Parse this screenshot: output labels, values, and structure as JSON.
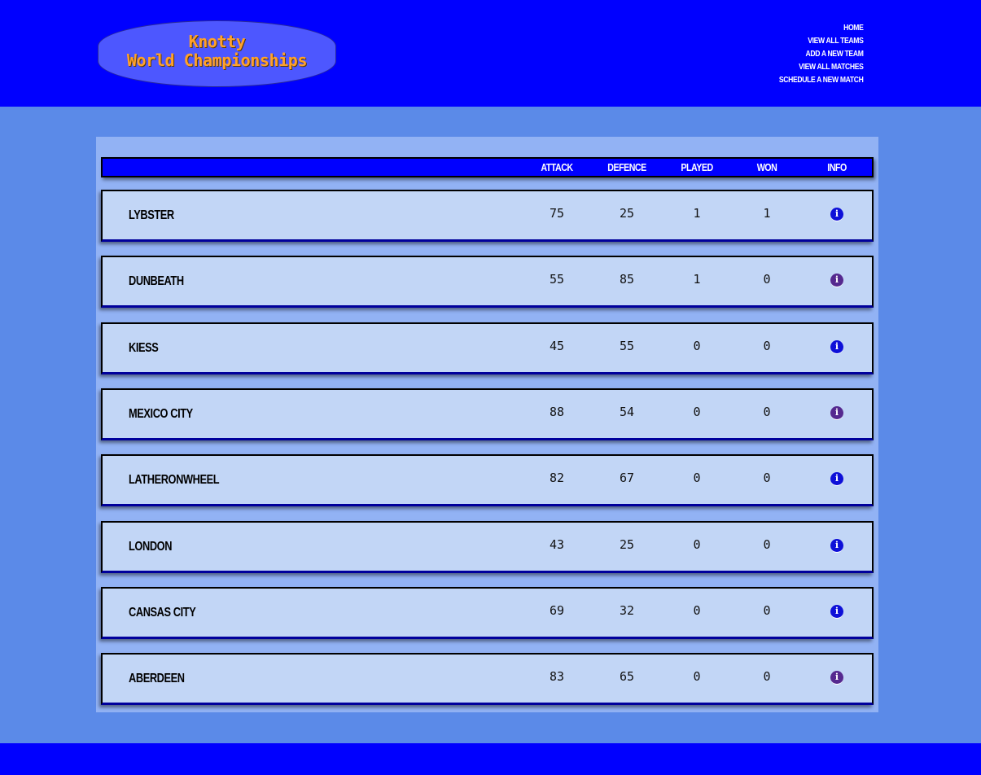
{
  "logo": {
    "line1": "Knotty",
    "line2": "World Championships"
  },
  "nav": {
    "items": [
      {
        "label": "HOME"
      },
      {
        "label": "VIEW ALL TEAMS"
      },
      {
        "label": "ADD A NEW TEAM"
      },
      {
        "label": "VIEW ALL MATCHES"
      },
      {
        "label": "SCHEDULE A NEW MATCH"
      }
    ]
  },
  "table": {
    "headers": {
      "attack": "ATTACK",
      "defence": "DEFENCE",
      "played": "PLAYED",
      "won": "WON",
      "info": "INFO"
    },
    "rows": [
      {
        "name": "LYBSTER",
        "attack": "75",
        "defence": "25",
        "played": "1",
        "won": "1",
        "info_icon": "info-icon",
        "link_state": "unvisited"
      },
      {
        "name": "DUNBEATH",
        "attack": "55",
        "defence": "85",
        "played": "1",
        "won": "0",
        "info_icon": "info-icon",
        "link_state": "visited"
      },
      {
        "name": "KIESS",
        "attack": "45",
        "defence": "55",
        "played": "0",
        "won": "0",
        "info_icon": "info-icon",
        "link_state": "unvisited"
      },
      {
        "name": "MEXICO CITY",
        "attack": "88",
        "defence": "54",
        "played": "0",
        "won": "0",
        "info_icon": "info-icon",
        "link_state": "visited"
      },
      {
        "name": "LATHERONWHEEL",
        "attack": "82",
        "defence": "67",
        "played": "0",
        "won": "0",
        "info_icon": "info-icon",
        "link_state": "unvisited"
      },
      {
        "name": "LONDON",
        "attack": "43",
        "defence": "25",
        "played": "0",
        "won": "0",
        "info_icon": "info-icon",
        "link_state": "unvisited"
      },
      {
        "name": "CANSAS CITY",
        "attack": "69",
        "defence": "32",
        "played": "0",
        "won": "0",
        "info_icon": "info-icon",
        "link_state": "unvisited"
      },
      {
        "name": "ABERDEEN",
        "attack": "83",
        "defence": "65",
        "played": "0",
        "won": "0",
        "info_icon": "info-icon",
        "link_state": "visited"
      }
    ]
  },
  "colors": {
    "header_bg": "#0000ff",
    "page_bg": "#5b8ae8",
    "panel_bg": "#92b2f4",
    "row_bg": "#c2d6f6",
    "logo_bg": "#4d57ff",
    "logo_text": "#ffa12a",
    "link_unvisited": "#0e10d8",
    "link_visited": "#55298f"
  }
}
